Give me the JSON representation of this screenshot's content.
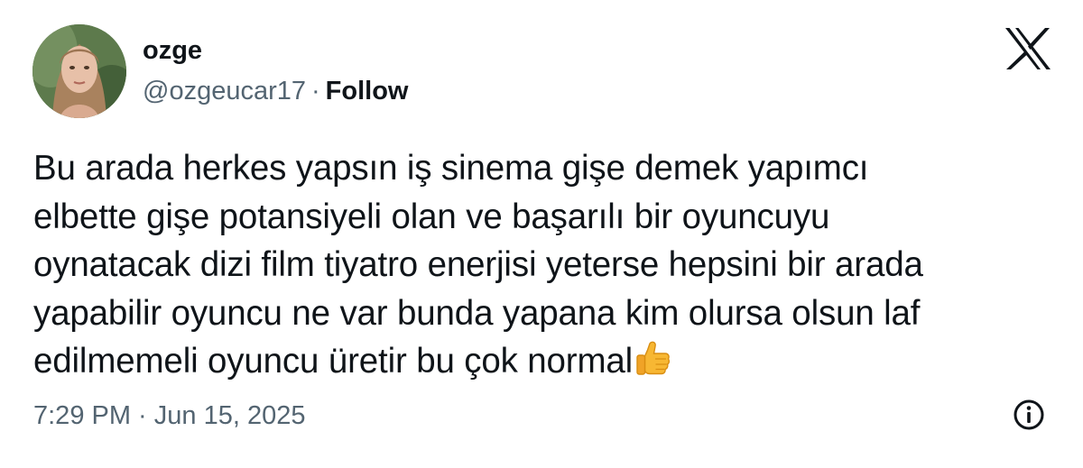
{
  "author": {
    "display_name": "ozge",
    "handle": "@ozgeucar17",
    "separator": "·",
    "follow_label": "Follow"
  },
  "tweet": {
    "lines": [
      "Bu arada herkes yapsın iş sinema gişe demek yapımcı",
      "elbette gişe potansiyeli olan ve başarılı bir oyuncuyu",
      "oynatacak dizi film tiyatro enerjisi yeterse hepsini bir arada",
      "yapabilir oyuncu ne var bunda yapana kim olursa olsun laf",
      "edilmemeli oyuncu üretir bu çok normal"
    ],
    "emoji": "thumbs-up"
  },
  "footer": {
    "timestamp": "7:29 PM · Jun 15, 2025"
  },
  "icons": {
    "brand": "x-logo-icon",
    "info": "info-icon"
  },
  "colors": {
    "text_primary": "#0f1419",
    "text_secondary": "#536471"
  }
}
